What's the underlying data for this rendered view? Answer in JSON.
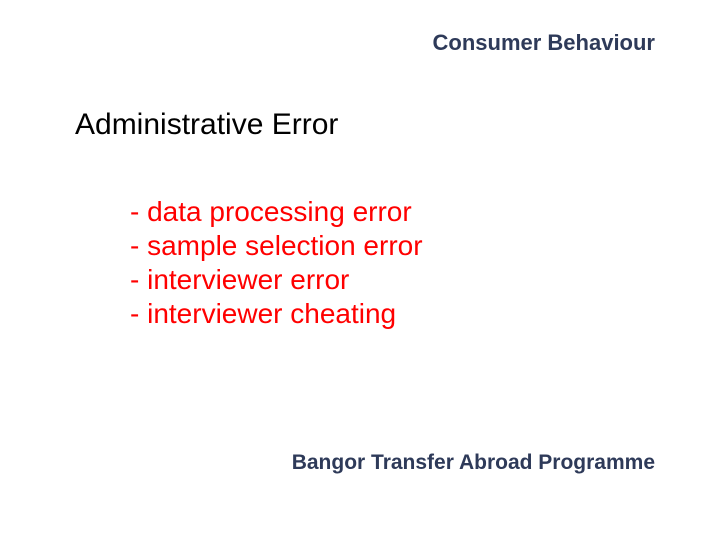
{
  "header": "Consumer Behaviour",
  "title": "Administrative Error",
  "items": [
    "- data processing error",
    "- sample selection error",
    "- interviewer error",
    "- interviewer cheating"
  ],
  "footer": "Bangor Transfer Abroad Programme"
}
